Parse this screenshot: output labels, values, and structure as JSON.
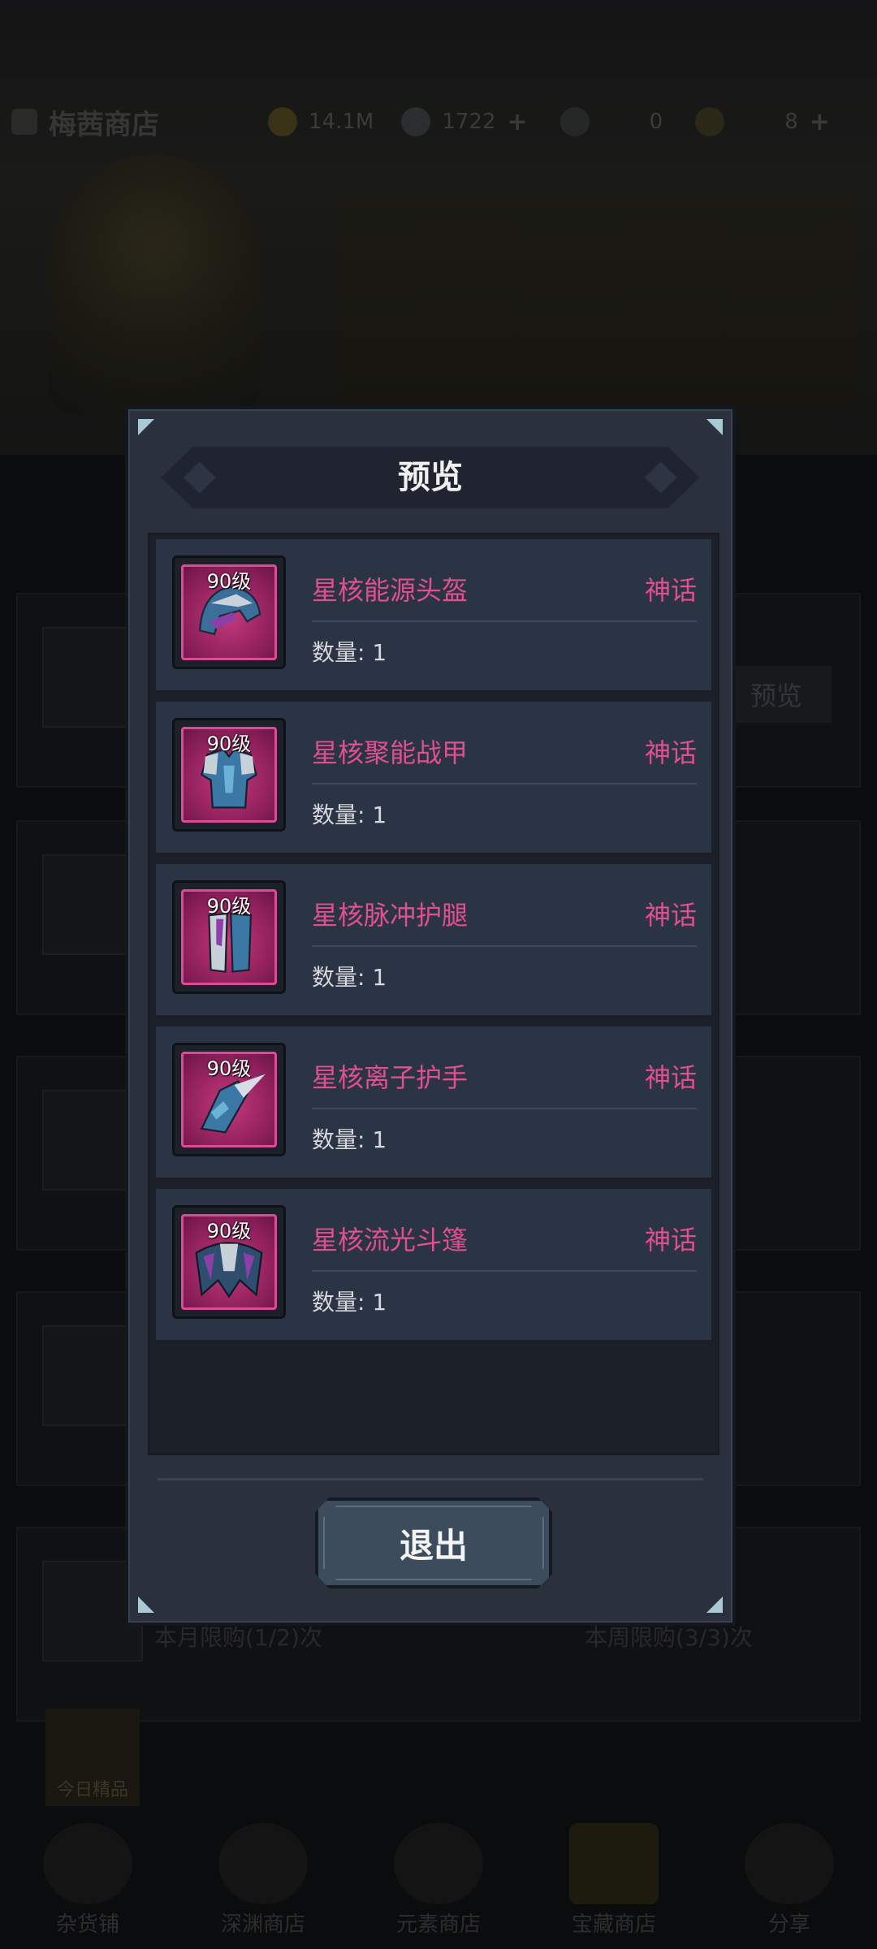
{
  "background": {
    "shop_title": "梅茜商店",
    "resources": [
      "14.1M",
      "1722",
      "0",
      "8"
    ],
    "preview_button": "预览",
    "limits": [
      "本月限购(1/2)次",
      "本周限购(3/3)次"
    ],
    "today_pick": "今日精品",
    "nav": [
      "杂货铺",
      "深渊商店",
      "元素商店",
      "宝藏商店",
      "分享"
    ]
  },
  "modal": {
    "title": "预览",
    "exit_label": "退出",
    "items": [
      {
        "level": "90级",
        "name": "星核能源头盔",
        "rarity": "神话",
        "qty": "数量: 1",
        "icon": "helmet"
      },
      {
        "level": "90级",
        "name": "星核聚能战甲",
        "rarity": "神话",
        "qty": "数量: 1",
        "icon": "armor"
      },
      {
        "level": "90级",
        "name": "星核脉冲护腿",
        "rarity": "神话",
        "qty": "数量: 1",
        "icon": "leggings"
      },
      {
        "level": "90级",
        "name": "星核离子护手",
        "rarity": "神话",
        "qty": "数量: 1",
        "icon": "gauntlet"
      },
      {
        "level": "90级",
        "name": "星核流光斗篷",
        "rarity": "神话",
        "qty": "数量: 1",
        "icon": "cloak"
      }
    ]
  },
  "colors": {
    "rarity_mythic": "#e0508f",
    "panel": "#2a303c",
    "item_bg": "#2b3444"
  }
}
